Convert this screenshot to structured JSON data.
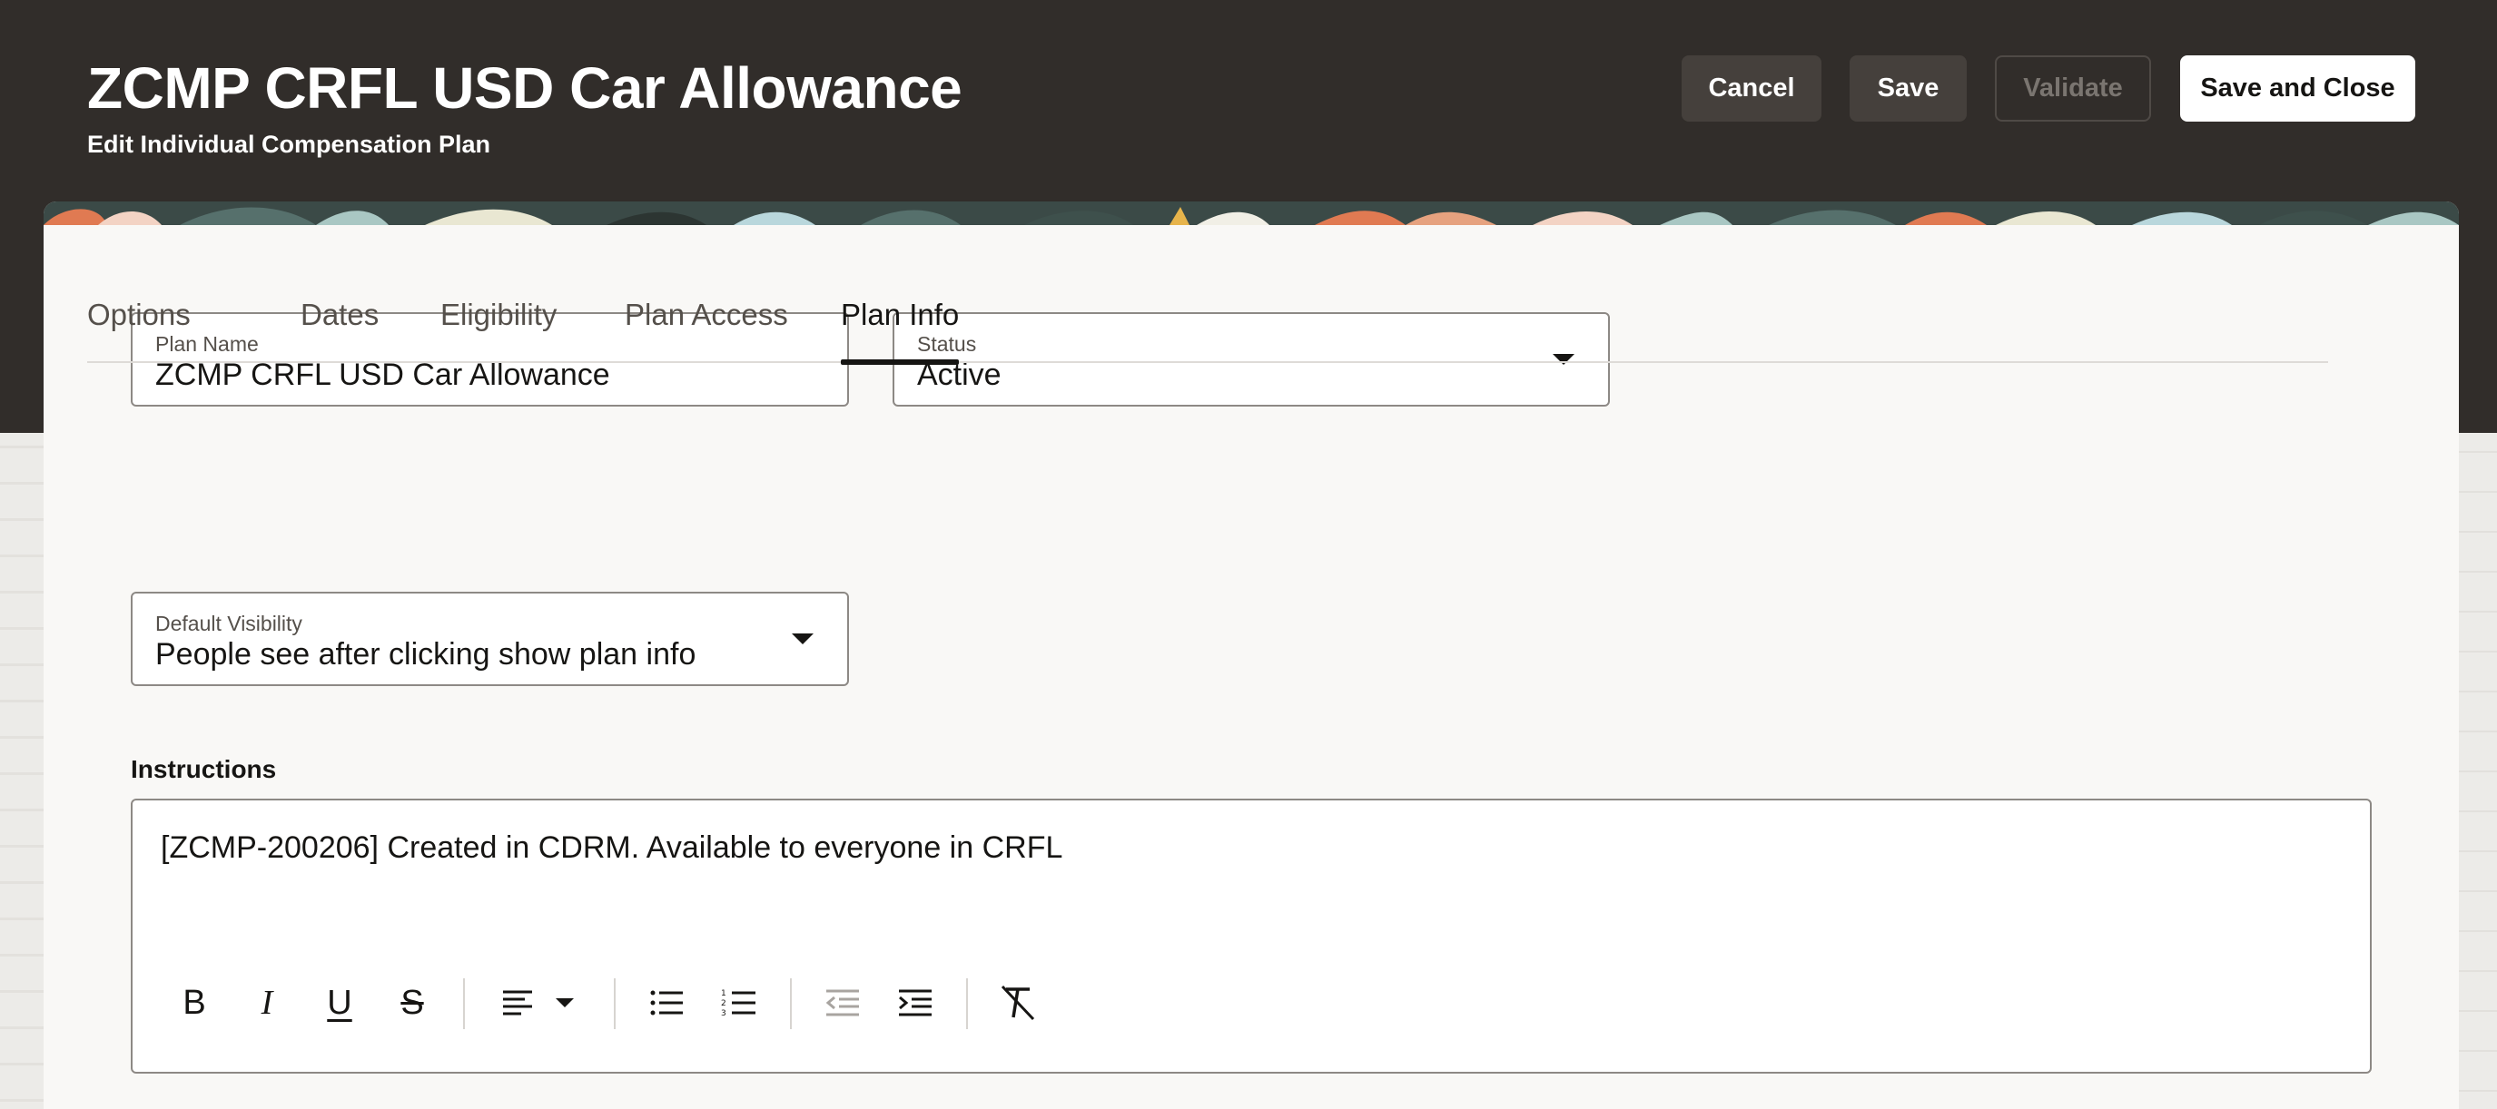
{
  "header": {
    "title": "ZCMP CRFL USD Car Allowance",
    "subtitle": "Edit Individual Compensation Plan",
    "buttons": {
      "cancel": "Cancel",
      "save": "Save",
      "validate": "Validate",
      "save_and_close": "Save and Close"
    }
  },
  "form": {
    "plan_name": {
      "label": "Plan Name",
      "value": "ZCMP CRFL USD Car Allowance"
    },
    "status": {
      "label": "Status",
      "value": "Active"
    }
  },
  "tabs": [
    {
      "label": "Options",
      "active": false
    },
    {
      "label": "Dates",
      "active": false
    },
    {
      "label": "Eligibility",
      "active": false
    },
    {
      "label": "Plan Access",
      "active": false
    },
    {
      "label": "Plan Info",
      "active": true
    }
  ],
  "plan_info": {
    "default_visibility": {
      "label": "Default Visibility",
      "value": "People see after clicking show plan info"
    },
    "instructions_label": "Instructions",
    "instructions_text": "[ZCMP-200206] Created in CDRM. Available to everyone in CRFL"
  },
  "editor_toolbar": {
    "bold_glyph": "B",
    "italic_glyph": "I",
    "underline_glyph": "U",
    "strikethrough_glyph": "S",
    "items": [
      "bold-icon",
      "italic-icon",
      "underline-icon",
      "strikethrough-icon",
      "align-left-icon",
      "chevron-down-icon",
      "bulleted-list-icon",
      "numbered-list-icon",
      "outdent-icon",
      "indent-icon",
      "clear-formatting-icon"
    ],
    "disabled": [
      "outdent-icon"
    ]
  },
  "colors": {
    "header_bg": "#312d2a",
    "card_bg": "#f9f8f6",
    "button_dark": "#45403c",
    "text_primary": "#161513",
    "text_secondary": "#55504b"
  }
}
